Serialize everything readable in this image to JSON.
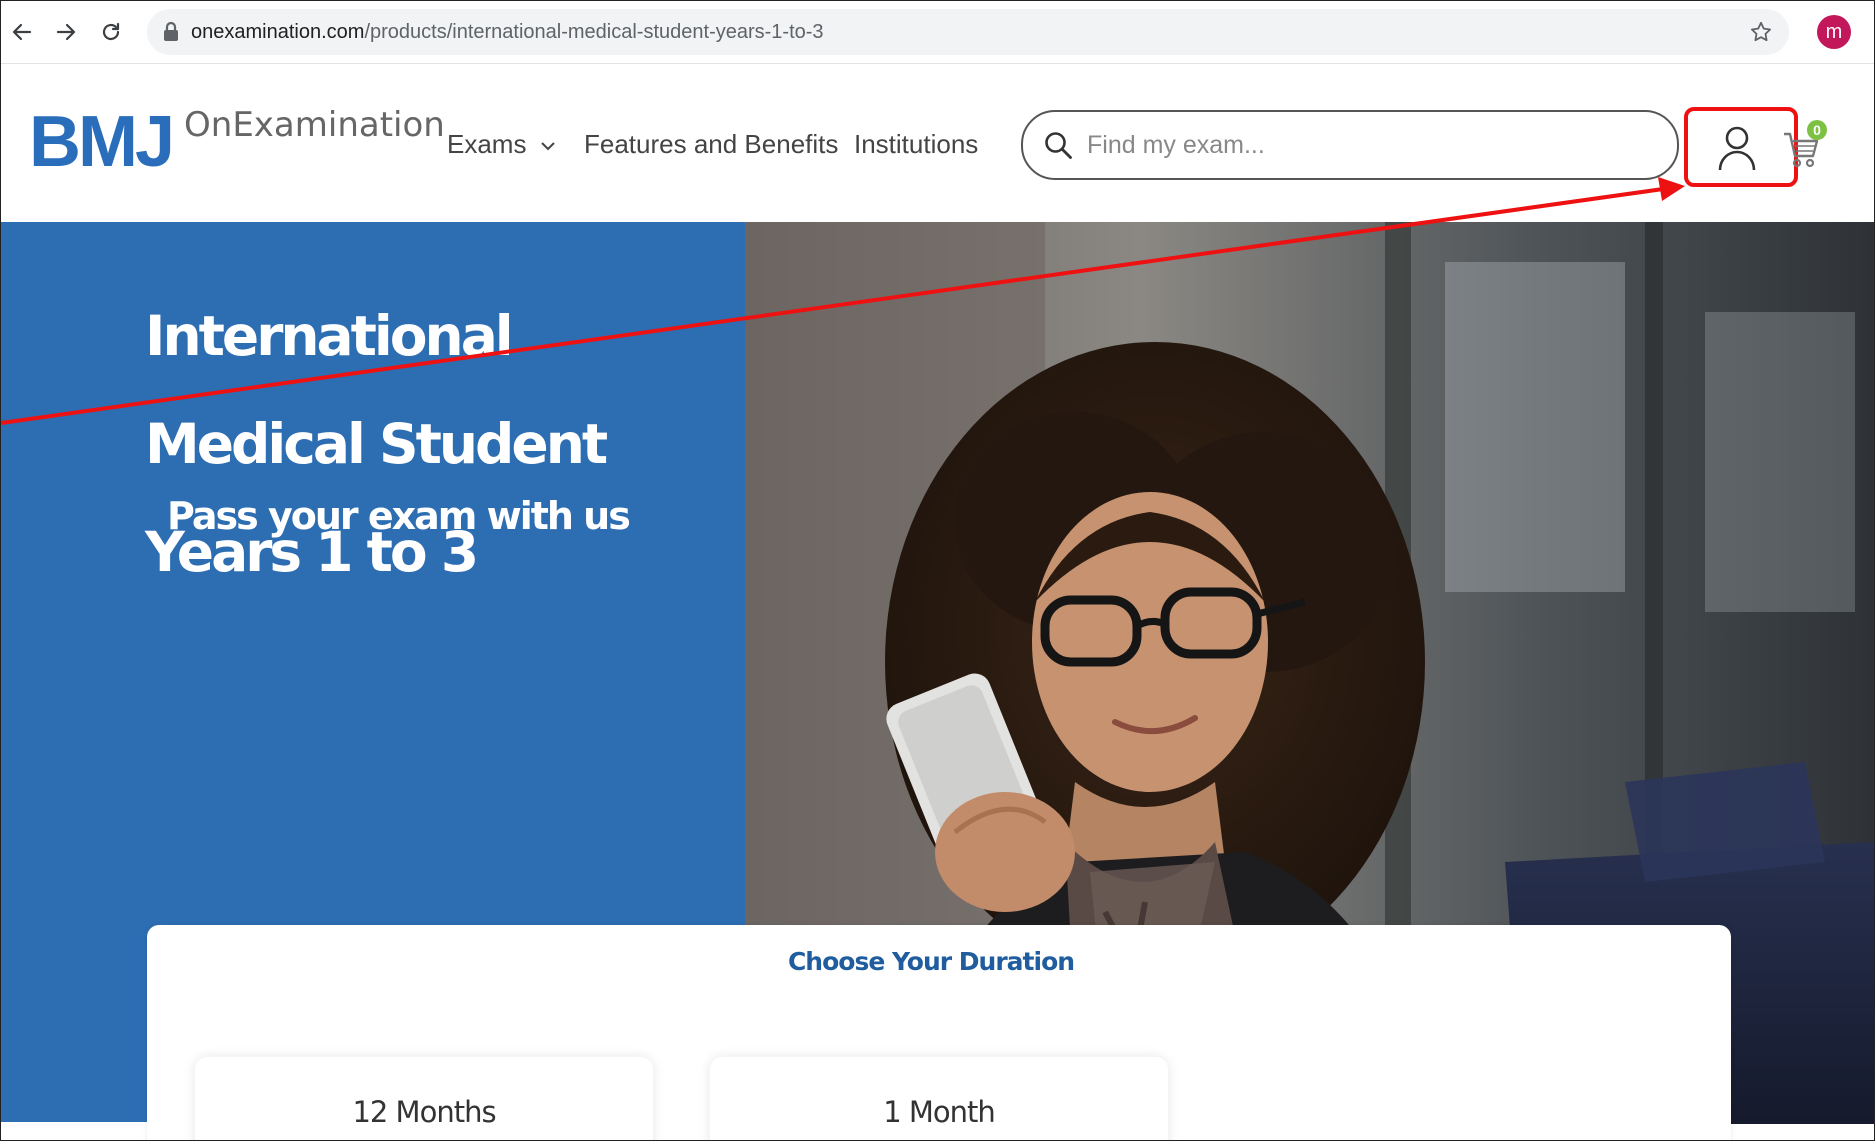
{
  "browser": {
    "url_host": "onexamination.com",
    "url_path": "/products/international-medical-student-years-1-to-3",
    "profile_initial": "m"
  },
  "header": {
    "logo_mark": "BMJ",
    "logo_text": "OnExamination",
    "nav": {
      "exams": "Exams",
      "features": "Features and Benefits",
      "institutions": "Institutions"
    },
    "search_placeholder": "Find my exam...",
    "cart_count": "0"
  },
  "hero": {
    "title": "International Medical Student Years 1 to 3",
    "subtitle": "Pass your exam with us"
  },
  "duration": {
    "heading": "Choose Your Duration",
    "options": [
      {
        "label": "12 Months"
      },
      {
        "label": "1 Month"
      }
    ]
  },
  "colors": {
    "brand_blue": "#2d6db2",
    "logo_blue": "#2a6ebb",
    "highlight_red": "#ee1111",
    "badge_green": "#7cc142"
  }
}
